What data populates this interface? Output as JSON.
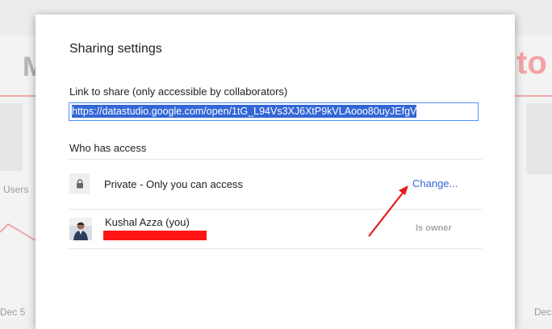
{
  "background": {
    "title_left": "M",
    "title_right": "to",
    "users_label": "Users",
    "date_left": "Dec 5",
    "date_right": "Dec"
  },
  "dialog": {
    "title": "Sharing settings",
    "link_label": "Link to share (only accessible by collaborators)",
    "link_value": "https://datastudio.google.com/open/1tG_L94Vs3XJ6XtP9kVLAooo80uyJEfgV",
    "access_heading": "Who has access",
    "private_text": "Private - Only you can access",
    "change_link": "Change...",
    "user_name": "Kushal Azza (you)",
    "owner_label": "Is owner"
  },
  "icons": {
    "lock": "lock-icon",
    "avatar": "user-avatar"
  },
  "colors": {
    "link_blue": "#3367d6",
    "selection": "#3367d6",
    "annotation_red": "#ff1515"
  }
}
